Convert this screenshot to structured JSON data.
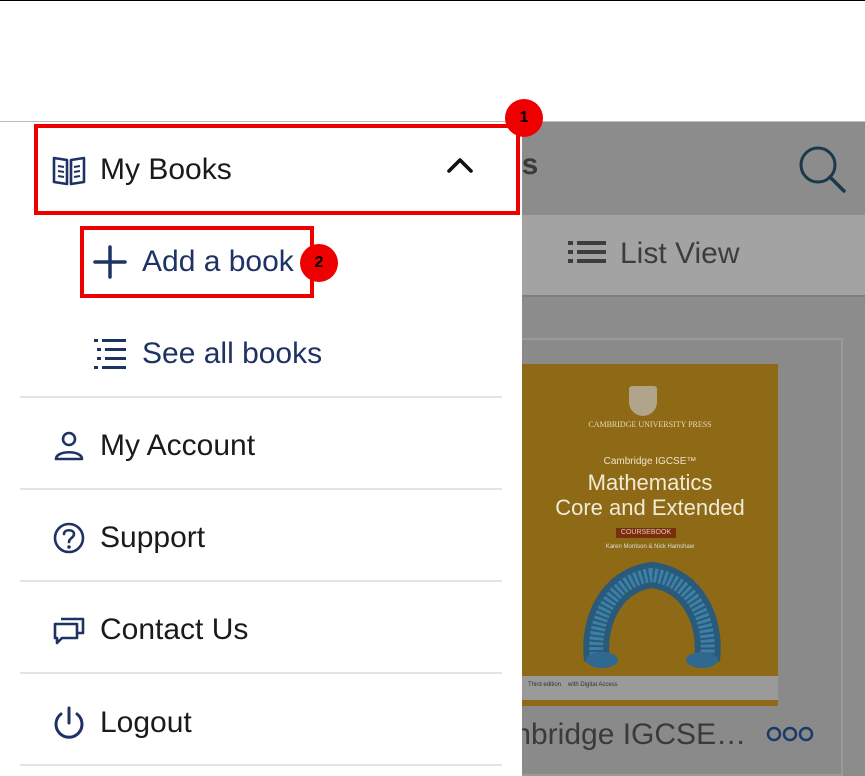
{
  "background_page": {
    "title_fragment": "es",
    "view_toggle_label": "List View",
    "book": {
      "cover": {
        "publisher": "CAMBRIDGE UNIVERSITY PRESS",
        "series": "Cambridge IGCSE™",
        "title_line1": "Mathematics",
        "title_line2": "Core and Extended",
        "badge": "COURSEBOOK",
        "authors": "Karen Morrison & Nick Hamshaw",
        "edition": "Third edition",
        "digital": "with Digital Access"
      },
      "title": "mbridge IGCSE…",
      "cover_color": "#e6a820"
    }
  },
  "menu": {
    "my_books": {
      "label": "My Books",
      "icon": "open-book-icon",
      "expanded": true
    },
    "sub_items": [
      {
        "label": "Add a book",
        "icon": "plus-icon"
      },
      {
        "label": "See all books",
        "icon": "list-icon"
      }
    ],
    "items": [
      {
        "label": "My Account",
        "icon": "person-icon"
      },
      {
        "label": "Support",
        "icon": "question-circle-icon"
      },
      {
        "label": "Contact Us",
        "icon": "chat-bubbles-icon"
      },
      {
        "label": "Logout",
        "icon": "power-icon"
      }
    ]
  },
  "annotations": {
    "marker_1": "1",
    "marker_2": "2",
    "highlight_color": "#ee0000"
  },
  "colors": {
    "nav_blue": "#1e3264",
    "text_dark": "#1a1a1a",
    "overlay_gray": "#8c8c8c"
  }
}
